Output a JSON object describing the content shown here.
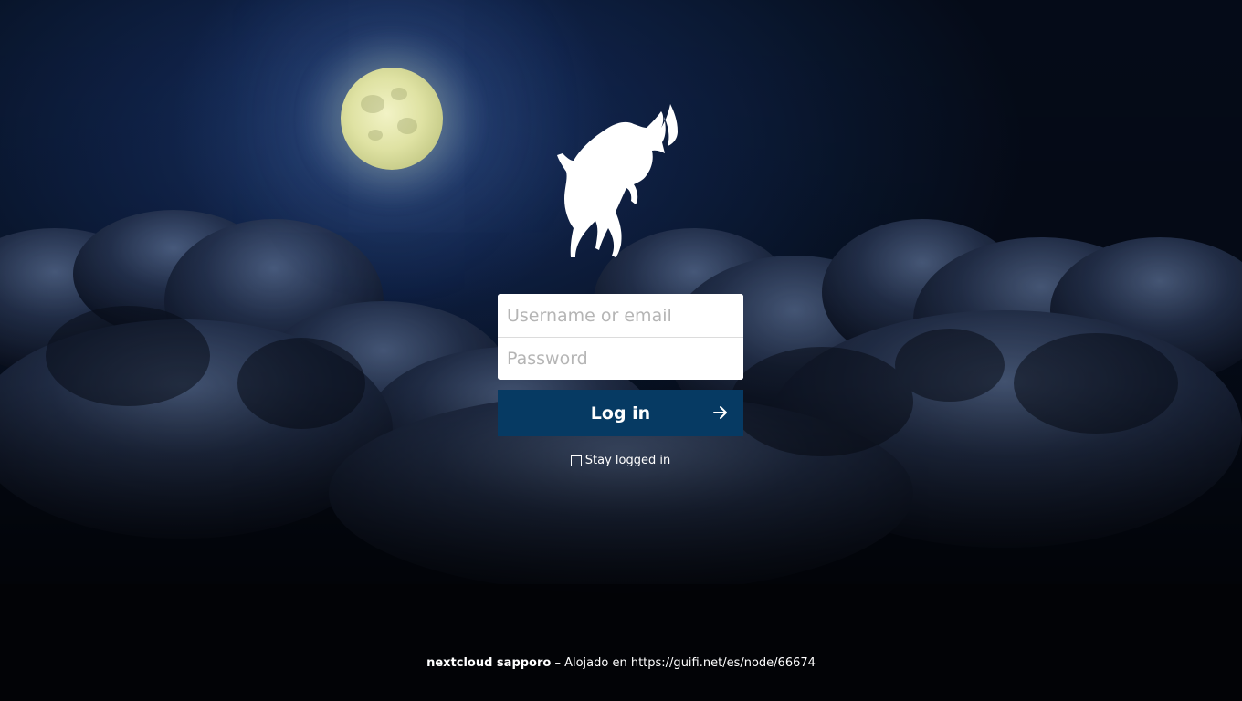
{
  "login": {
    "username_placeholder": "Username or email",
    "password_placeholder": "Password",
    "button_label": "Log in",
    "remember_label": "Stay logged in"
  },
  "footer": {
    "brand": "nextcloud sapporo",
    "separator": " – ",
    "hosted_text": "Alojado en https://guifi.net/es/node/66674"
  },
  "colors": {
    "button": "#063a63",
    "text": "#ffffff"
  },
  "icons": {
    "logo": "goat-logo-icon",
    "submit": "arrow-right-icon",
    "checkbox": "checkbox-icon"
  }
}
